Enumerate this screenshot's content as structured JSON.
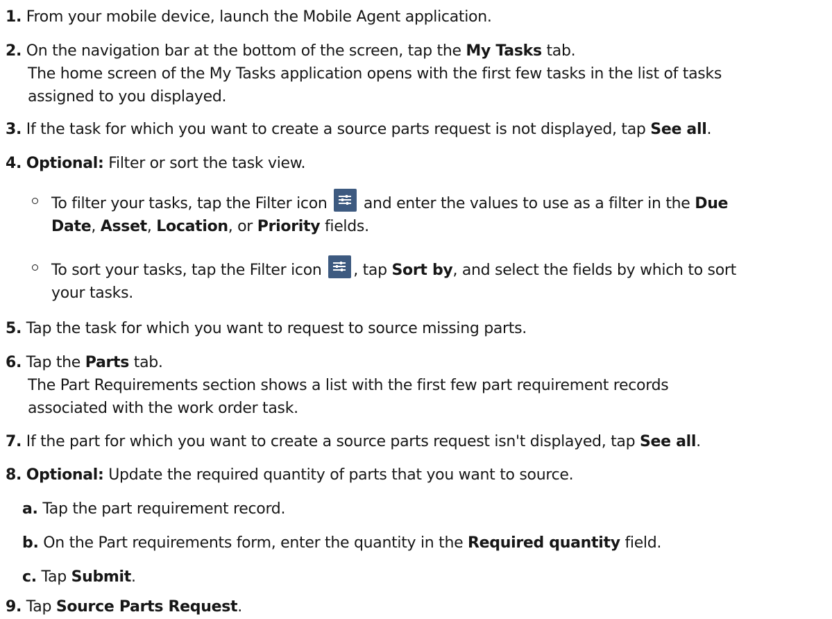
{
  "steps": [
    {
      "num": "1.",
      "parts": [
        "From your mobile device, launch the Mobile Agent application."
      ]
    },
    {
      "num": "2.",
      "a": "On the navigation bar at the bottom of the screen, tap the ",
      "b": "My Tasks",
      "c": " tab.",
      "line2": "The home screen of the My Tasks application opens with the first few tasks in the list of tasks",
      "line3": "assigned to you displayed."
    },
    {
      "num": "3.",
      "a": "If the task for which you want to create a source parts request is not displayed, tap ",
      "b": "See all",
      "c": "."
    },
    {
      "num": "4.",
      "b": "Optional:",
      "c": " Filter or sort the task view."
    },
    {
      "num": "5.",
      "a": "Tap the task for which you want to request to source missing parts."
    },
    {
      "num": "6.",
      "a": "Tap the ",
      "b": "Parts",
      "c": " tab.",
      "line2": "The Part Requirements section shows a list with the first few part requirement records",
      "line3": "associated with the work order task."
    },
    {
      "num": "7.",
      "a": "If the part for which you want to create a source parts request isn't displayed, tap ",
      "b": "See all",
      "c": "."
    },
    {
      "num": "8.",
      "b": "Optional:",
      "c": " Update the required quantity of parts that you want to source."
    },
    {
      "num": "9.",
      "a": "Tap ",
      "b": "Source Parts Request",
      "c": "."
    }
  ],
  "bullets": [
    {
      "a": "To filter your tasks, tap the Filter icon ",
      "b": " and enter the values to use as a filter in the ",
      "f1": "Due",
      "f1b": "Date",
      "s1": ", ",
      "f2": "Asset",
      "s2": ", ",
      "f3": "Location",
      "s3": ", or ",
      "f4": "Priority",
      "end": " fields."
    },
    {
      "a": "To sort your tasks, tap the Filter icon ",
      "b": ", tap ",
      "bold": "Sort by",
      "c": ", and select the fields by which to sort",
      "line2": "your tasks."
    }
  ],
  "substeps": [
    {
      "num": "a.",
      "a": "Tap the part requirement record."
    },
    {
      "num": "b.",
      "a": "On the Part requirements form, enter the quantity in the ",
      "b": "Required quantity",
      "c": " field."
    },
    {
      "num": "c.",
      "a": "Tap ",
      "b": "Submit",
      "c": "."
    }
  ],
  "icons": {
    "filter": "filter-icon"
  },
  "colors": {
    "icon_bg": "#3d5a80"
  }
}
